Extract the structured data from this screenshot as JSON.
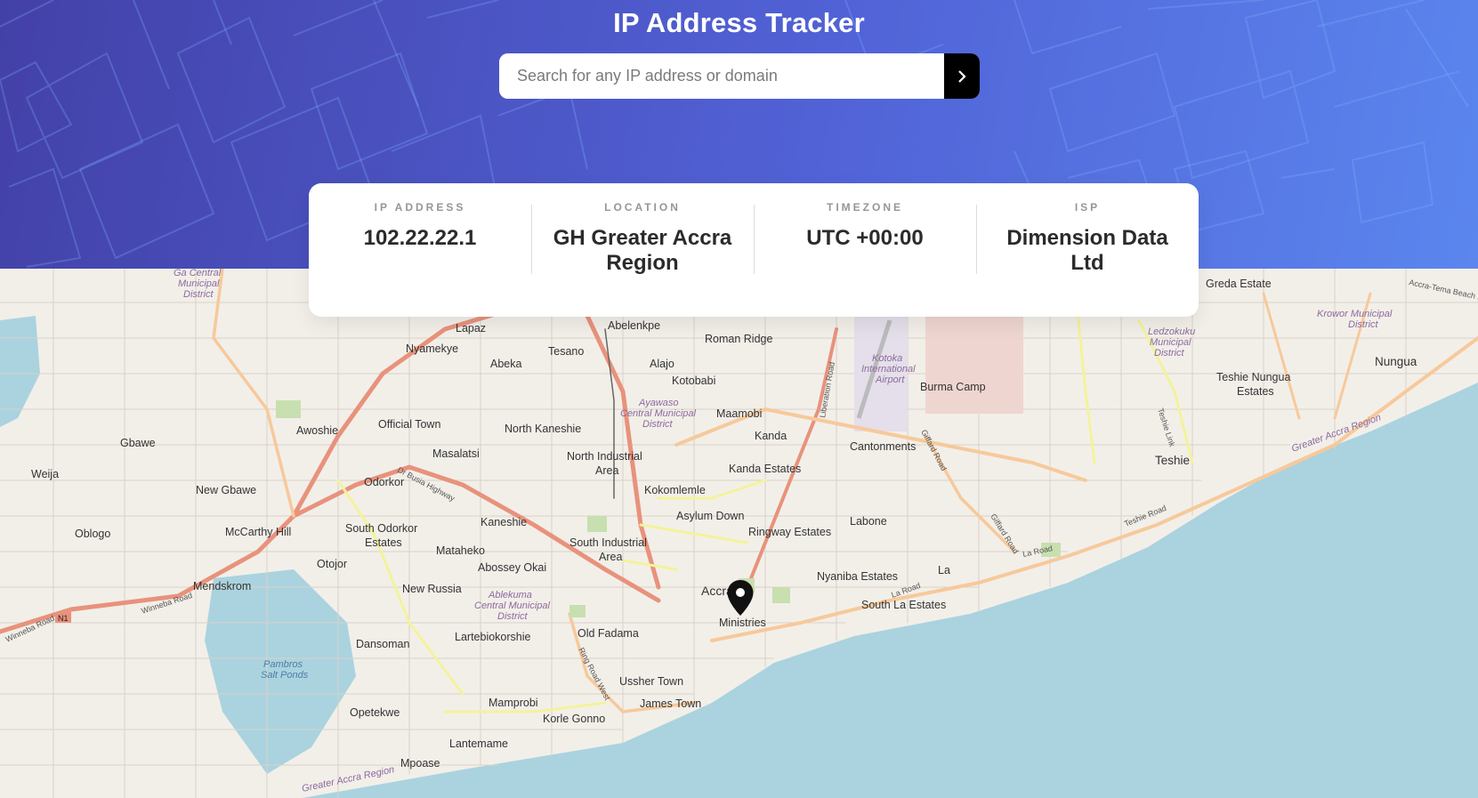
{
  "app": {
    "title": "IP Address Tracker"
  },
  "search": {
    "placeholder": "Search for any IP address or domain",
    "value": "",
    "submit_icon": "chevron-right-icon"
  },
  "info": {
    "ip_address": {
      "label": "IP Address",
      "value": "102.22.22.1"
    },
    "location": {
      "label": "Location",
      "value": "GH Greater Accra Region"
    },
    "timezone": {
      "label": "Timezone",
      "value": "UTC +00:00"
    },
    "isp": {
      "label": "ISP",
      "value": "Dimension Data Ltd"
    }
  },
  "map": {
    "marker_icon": "location-pin-icon",
    "place_labels": [
      "Lapaz",
      "Abelenkpe",
      "Roman Ridge",
      "Nyamekye",
      "Tesano",
      "Alajo",
      "Abeka",
      "Kotobabi",
      "Maamobi",
      "Burma Camp",
      "Kanda",
      "Gbawe",
      "Awoshie",
      "Official Town",
      "North Kaneshie",
      "Weija",
      "Masalatsi",
      "North Industrial Area",
      "Cantonments",
      "Kanda Estates",
      "Odorkor",
      "New Gbawe",
      "Kokomlemle",
      "Kaneshie",
      "Asylum Down",
      "Labone",
      "McCarthy Hill",
      "South Odorkor Estates",
      "Oblogo",
      "Ringway Estates",
      "South Industrial Area",
      "Mataheko",
      "Otojor",
      "Abossey Okai",
      "Nyaniba Estates",
      "La",
      "Mendskrom",
      "New Russia",
      "Accra",
      "South La Estates",
      "Ministries",
      "Old Fadama",
      "Dansoman",
      "Lartebiokorshie",
      "Ussher Town",
      "James Town",
      "Mamprobi",
      "Opetekwe",
      "Korle Gonno",
      "Lantemame",
      "Mpoase",
      "Greda Estate",
      "Nungua",
      "Teshie Nungua Estates",
      "Teshie"
    ],
    "district_labels": [
      "Ga Central Municipal District",
      "Ayawaso Central Municipal District",
      "Ablekuma Central Municipal District",
      "Ledzokuku Municipal District",
      "Krowor Municipal District",
      "Kotoka International Airport",
      "Greater Accra Region",
      "Pambros Salt Ponds"
    ],
    "road_labels": [
      "Dr Busia Highway",
      "Winneba Road",
      "N1",
      "La Road",
      "Teshie Road",
      "Giffard Road",
      "Liberation Road",
      "Ring Road West",
      "Teshie Link",
      "Accra-Tema Beach Rd"
    ],
    "colors": {
      "sea": "#aad3df",
      "land": "#f2efe9",
      "major_road": "#e8927c",
      "secondary_road": "#f7c99a",
      "tertiary_road": "#f3f39b"
    }
  }
}
